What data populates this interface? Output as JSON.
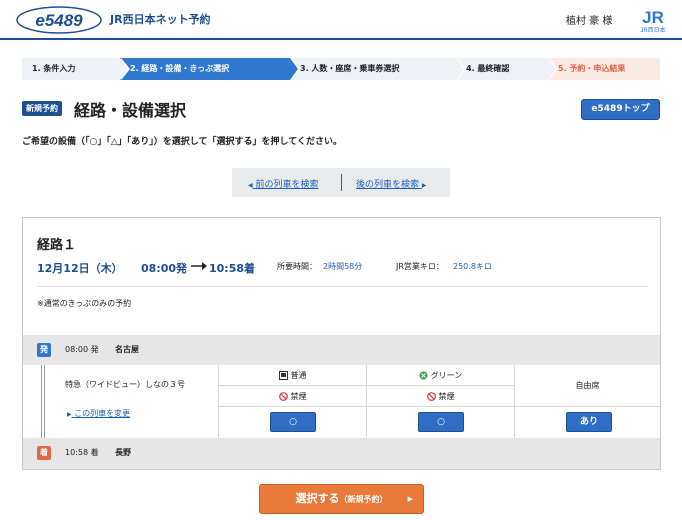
{
  "header": {
    "site_title": "JR西日本ネット予約",
    "logo_text": "e5489",
    "user_name": "植村 豪 様",
    "jr_logo_text": "JR西日本",
    "logo_icon": "e5489-logo",
    "jr_icon": "jr-west-logo"
  },
  "steps": [
    {
      "label": "1. 条件入力",
      "state": "done"
    },
    {
      "label": "2. 経路・設備・きっぷ選択",
      "state": "current"
    },
    {
      "label": "3. 人数・座席・乗車券選択",
      "state": "todo"
    },
    {
      "label": "4. 最終確認",
      "state": "todo"
    },
    {
      "label": "5. 予約・申込結果",
      "state": "final"
    }
  ],
  "page": {
    "badge": "新規予約",
    "title": "経路・設備選択",
    "top_button": "e5489トップ",
    "instruction": "ご希望の設備（「○」「△」「あり」）を選択して「選択する」を押してください。"
  },
  "nav": {
    "prev": "前の列車を検索",
    "next": "後の列車を検索"
  },
  "route": {
    "title": "経路１",
    "date": "12月12日（木）",
    "dep_time": "08:00発",
    "arr_time": "10:58着",
    "duration_label": "所要時間：",
    "duration": "2時間58分",
    "km_label": "JR営業キロ：",
    "km": "250.8キロ",
    "note": "※通常のきっぷのみの予約",
    "departure": {
      "badge": "発",
      "time": "08:00 発",
      "station": "名古屋"
    },
    "arrival": {
      "badge": "着",
      "time": "10:58 着",
      "station": "長野"
    },
    "train": {
      "name": "特急（ワイドビュー）しなの３号",
      "change_link": "この列車を変更"
    },
    "seats": [
      {
        "class": "普通",
        "class_icon": "ordinary-car-icon",
        "smoking": "禁煙",
        "smoking_icon": "no-smoking-icon",
        "availability": "○"
      },
      {
        "class": "グリーン",
        "class_icon": "green-car-icon",
        "smoking": "禁煙",
        "smoking_icon": "no-smoking-icon",
        "availability": "○"
      },
      {
        "class": "自由席",
        "availability": "あり"
      }
    ]
  },
  "select_button": {
    "label": "選択する",
    "sub": "（新規予約）"
  },
  "colors": {
    "primary": "#1d4f91",
    "accent_blue": "#2f78d0",
    "orange": "#e87a3a",
    "step_final": "#e2664a"
  }
}
